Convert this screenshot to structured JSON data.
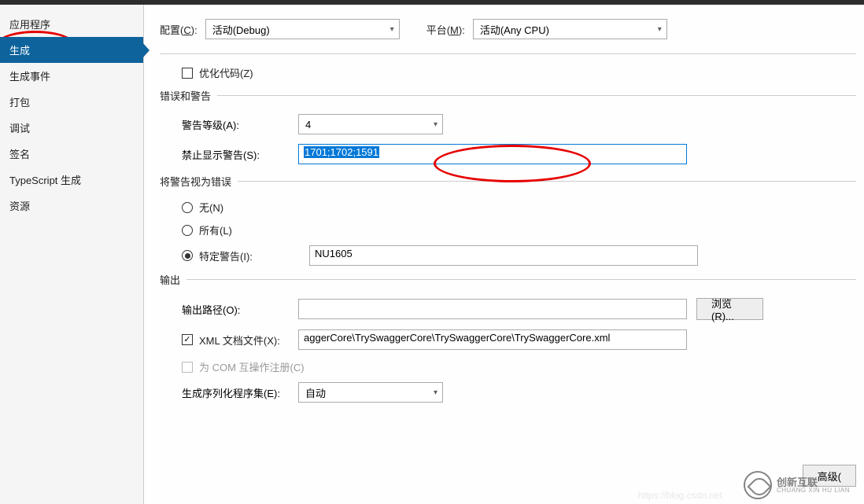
{
  "sidebar": {
    "items": [
      {
        "label": "应用程序"
      },
      {
        "label": "生成"
      },
      {
        "label": "生成事件"
      },
      {
        "label": "打包"
      },
      {
        "label": "调试"
      },
      {
        "label": "签名"
      },
      {
        "label": "TypeScript 生成"
      },
      {
        "label": "资源"
      }
    ]
  },
  "top": {
    "config_label_pre": "配置(",
    "config_label_u": "C",
    "config_label_post": "):",
    "config_value": "活动(Debug)",
    "platform_label_pre": "平台(",
    "platform_label_u": "M",
    "platform_label_post": "):",
    "platform_value": "活动(Any CPU)"
  },
  "optimize": {
    "label": "优化代码(Z)"
  },
  "section_errors": "错误和警告",
  "warn_level": {
    "label": "警告等级(A):",
    "value": "4"
  },
  "suppress": {
    "label": "禁止显示警告(S):",
    "value": "1701;1702;1591"
  },
  "section_treat_as_errors": "将警告视为错误",
  "radio_none": "无(N)",
  "radio_all": "所有(L)",
  "radio_specific_label": "特定警告(I):",
  "specific_value": "NU1605",
  "section_output": "输出",
  "output_path": {
    "label": "输出路径(O):"
  },
  "browse_btn": "浏览(R)...",
  "xml_doc": {
    "label": "XML 文档文件(X):",
    "value": "aggerCore\\TrySwaggerCore\\TrySwaggerCore\\TrySwaggerCore.xml"
  },
  "com_register": {
    "label": "为 COM 互操作注册(C)"
  },
  "serialization": {
    "label": "生成序列化程序集(E):",
    "value": "自动"
  },
  "advanced_btn": "高级(",
  "watermark": {
    "cn": "创新互联",
    "en": "CHUANG XIN HU LIAN"
  },
  "faint_url": "https://blog.csdn.net"
}
